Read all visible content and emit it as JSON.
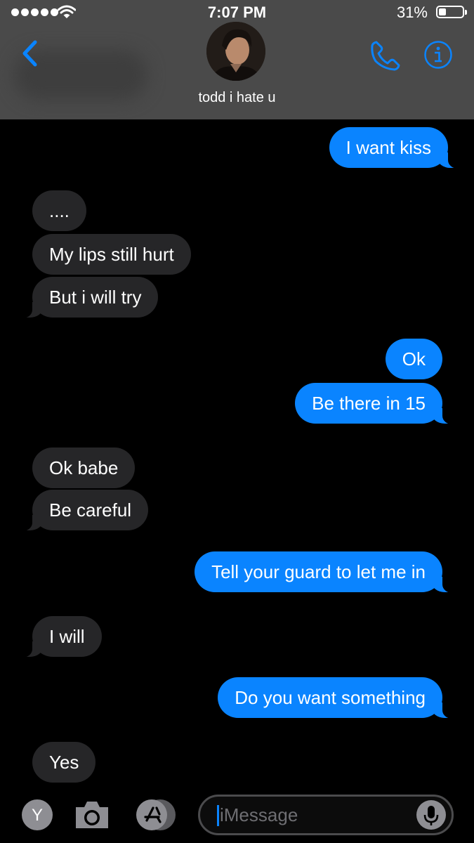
{
  "status": {
    "time": "7:07 PM",
    "battery_percent": "31%",
    "battery_level": 0.31,
    "signal_bars": 5
  },
  "header": {
    "contact_name": "todd i hate u"
  },
  "messages": [
    {
      "text": "I want kiss",
      "direction": "outgoing"
    },
    {
      "text": "....",
      "direction": "incoming"
    },
    {
      "text": "My lips still hurt",
      "direction": "incoming"
    },
    {
      "text": "But i will try",
      "direction": "incoming"
    },
    {
      "text": "Ok",
      "direction": "outgoing"
    },
    {
      "text": "Be there in 15",
      "direction": "outgoing"
    },
    {
      "text": "Ok babe",
      "direction": "incoming"
    },
    {
      "text": "Be careful",
      "direction": "incoming"
    },
    {
      "text": "Tell your guard to let me in",
      "direction": "outgoing"
    },
    {
      "text": "I will",
      "direction": "incoming"
    },
    {
      "text": "Do you want something",
      "direction": "outgoing"
    },
    {
      "text": "Yes",
      "direction": "incoming"
    }
  ],
  "input_bar": {
    "app_badge_letter": "Y",
    "placeholder": "iMessage"
  },
  "colors": {
    "outgoing_bubble": "#0a84ff",
    "incoming_bubble": "#262628",
    "header_bg": "#4a4a4a",
    "accent": "#0a84ff"
  },
  "icons": [
    "signal-dots-icon",
    "wifi-icon",
    "battery-icon",
    "chevron-left-icon",
    "phone-icon",
    "info-icon",
    "camera-icon",
    "app-store-icon",
    "microphone-icon"
  ]
}
